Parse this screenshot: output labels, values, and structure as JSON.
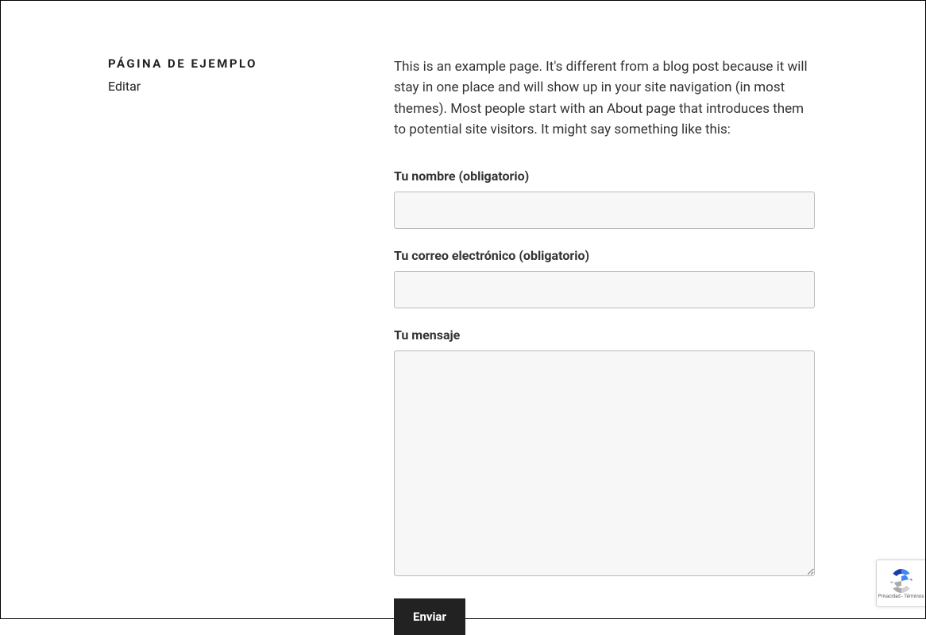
{
  "sidebar": {
    "title": "PÁGINA DE EJEMPLO",
    "edit_label": "Editar"
  },
  "main": {
    "intro": "This is an example page. It's different from a blog post because it will stay in one place and will show up in your site navigation (in most themes). Most people start with an About page that introduces them to potential site visitors. It might say something like this:",
    "form": {
      "name_label": "Tu nombre (obligatorio)",
      "email_label": "Tu correo electrónico (obligatorio)",
      "message_label": "Tu mensaje",
      "submit_label": "Enviar"
    }
  },
  "recaptcha": {
    "links": "Privacidad - Términos"
  }
}
